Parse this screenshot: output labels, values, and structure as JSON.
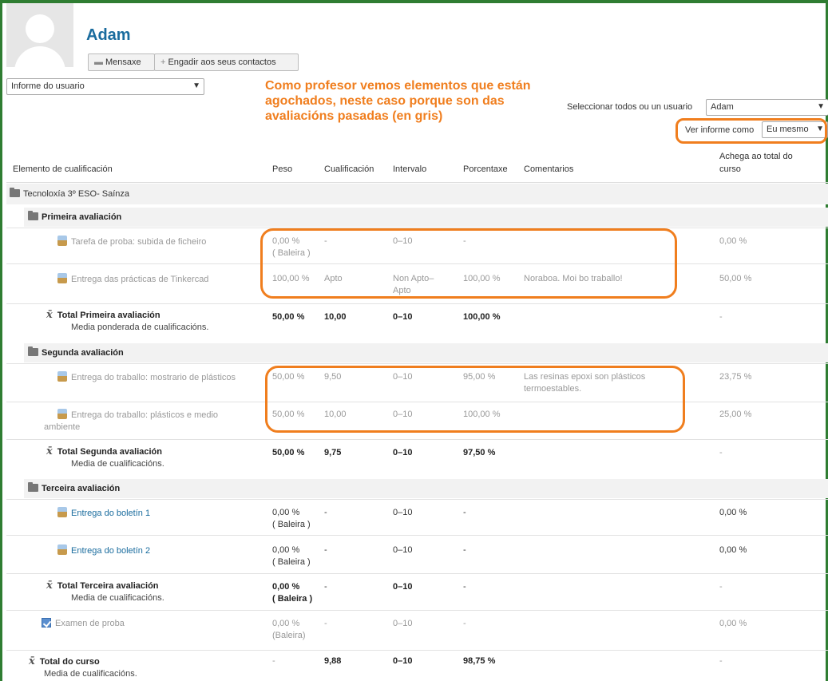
{
  "profile": {
    "name": "Adam",
    "message_button": "Mensaxe",
    "add_contact_button": "Engadir aos seus contactos"
  },
  "controls": {
    "report_select": "Informe do usuario",
    "select_user_label": "Seleccionar todos ou un usuario",
    "select_user_value": "Adam",
    "view_as_label": "Ver informe como",
    "view_as_value": "Eu mesmo"
  },
  "annotation": {
    "line1": "Como profesor vemos elementos que están",
    "line2": "agochados, neste caso porque son das",
    "line3": "avaliacións pasadas (en gris)"
  },
  "table": {
    "headers": {
      "item": "Elemento de cualificación",
      "weight": "Peso",
      "grade": "Cualificación",
      "range": "Intervalo",
      "percent": "Porcentaxe",
      "feedback": "Comentarios",
      "contrib1": "Achega ao total do",
      "contrib2": "curso"
    },
    "course": "Tecnoloxía 3º ESO- Saínza",
    "cat1": {
      "name": "Primeira avaliación",
      "items": [
        {
          "name": "Tarefa de proba: subida de ficheiro",
          "weight": "0,00 %",
          "weight2": "( Baleira )",
          "grade": "-",
          "range": "0–10",
          "percent": "-",
          "feedback": "",
          "contrib": "0,00 %"
        },
        {
          "name": "Entrega das prácticas de Tinkercad",
          "weight": "100,00 %",
          "grade": "Apto",
          "range": "Non Apto–",
          "range2": "Apto",
          "percent": "100,00 %",
          "feedback": "Noraboa. Moi bo traballo!",
          "contrib": "50,00 %"
        }
      ],
      "total": {
        "name": "Total Primeira avaliación",
        "sub": "Media ponderada de cualificacións.",
        "weight": "50,00 %",
        "grade": "10,00",
        "range": "0–10",
        "percent": "100,00 %",
        "contrib": "-"
      }
    },
    "cat2": {
      "name": "Segunda avaliación",
      "items": [
        {
          "name": "Entrega do traballo: mostrario de plásticos",
          "weight": "50,00 %",
          "grade": "9,50",
          "range": "0–10",
          "percent": "95,00 %",
          "feedback": "Las resinas epoxi son plásticos",
          "feedback2": "termoestables.",
          "contrib": "23,75 %"
        },
        {
          "name": "Entrega do traballo: plásticos e medio",
          "name2": "ambiente",
          "weight": "50,00 %",
          "grade": "10,00",
          "range": "0–10",
          "percent": "100,00 %",
          "contrib": "25,00 %"
        }
      ],
      "total": {
        "name": "Total Segunda avaliación",
        "sub": "Media de cualificacións.",
        "weight": "50,00 %",
        "grade": "9,75",
        "range": "0–10",
        "percent": "97,50 %",
        "contrib": "-"
      }
    },
    "cat3": {
      "name": "Terceira avaliación",
      "items": [
        {
          "name": "Entrega do boletín 1",
          "weight": "0,00 %",
          "weight2": "( Baleira )",
          "grade": "-",
          "range": "0–10",
          "percent": "-",
          "contrib": "0,00 %"
        },
        {
          "name": "Entrega do boletín 2",
          "weight": "0,00 %",
          "weight2": "( Baleira )",
          "grade": "-",
          "range": "0–10",
          "percent": "-",
          "contrib": "0,00 %"
        }
      ],
      "total": {
        "name": "Total Terceira avaliación",
        "sub": "Media de cualificacións.",
        "weight": "0,00 %",
        "weight2": "( Baleira )",
        "grade": "-",
        "range": "0–10",
        "percent": "-",
        "contrib": "-"
      }
    },
    "exam": {
      "name": "Examen de proba",
      "weight": "0,00 %",
      "weight2": "(Baleira)",
      "grade": "-",
      "range": "0–10",
      "percent": "-",
      "contrib": "0,00 %"
    },
    "course_total": {
      "name": "Total do curso",
      "sub": "Media de cualificacións.",
      "weight": "-",
      "grade": "9,88",
      "range": "0–10",
      "percent": "98,75 %",
      "contrib": "-"
    }
  }
}
